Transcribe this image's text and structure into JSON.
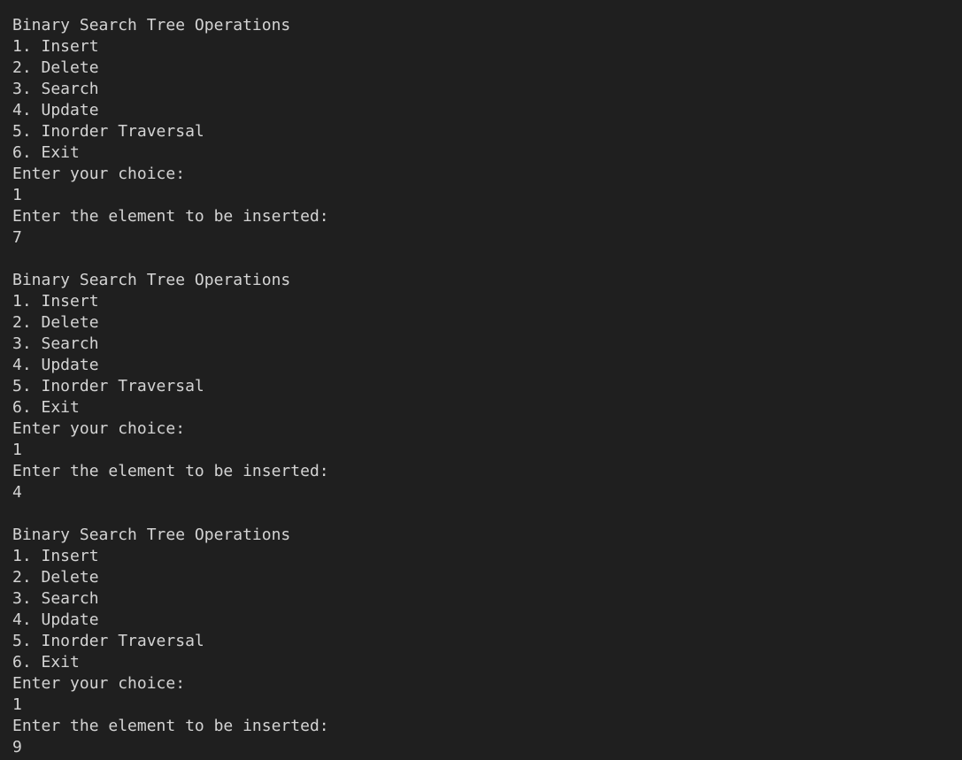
{
  "terminal": {
    "lines": [
      "Binary Search Tree Operations",
      "1. Insert",
      "2. Delete",
      "3. Search",
      "4. Update",
      "5. Inorder Traversal",
      "6. Exit",
      "Enter your choice:",
      "1",
      "Enter the element to be inserted:",
      "7",
      "",
      "Binary Search Tree Operations",
      "1. Insert",
      "2. Delete",
      "3. Search",
      "4. Update",
      "5. Inorder Traversal",
      "6. Exit",
      "Enter your choice:",
      "1",
      "Enter the element to be inserted:",
      "4",
      "",
      "Binary Search Tree Operations",
      "1. Insert",
      "2. Delete",
      "3. Search",
      "4. Update",
      "5. Inorder Traversal",
      "6. Exit",
      "Enter your choice:",
      "1",
      "Enter the element to be inserted:",
      "9"
    ]
  },
  "colors": {
    "background": "#1f1f1f",
    "text": "#d4d4d4"
  }
}
